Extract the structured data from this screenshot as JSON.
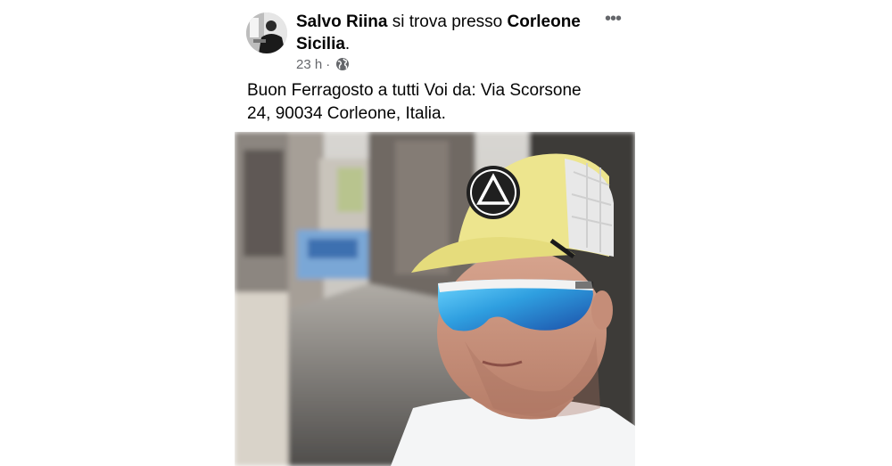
{
  "post": {
    "author": "Salvo Riina",
    "connector": " si trova presso ",
    "place_line1": "Corleone",
    "place_line2": "Sicilia",
    "place_suffix": ".",
    "time": "23 h",
    "separator": "·",
    "audience_icon": "globe-icon",
    "more_icon": "more-options-icon",
    "caption_line1": "Buon Ferragosto a tutti Voi da: Via Scorsone",
    "caption_line2": "24, 90034 Corleone, Italia."
  },
  "colors": {
    "text": "#050505",
    "secondary_text": "#65676b",
    "cap_yellow": "#ede58e",
    "lens_blue": "#2f9fe0"
  }
}
